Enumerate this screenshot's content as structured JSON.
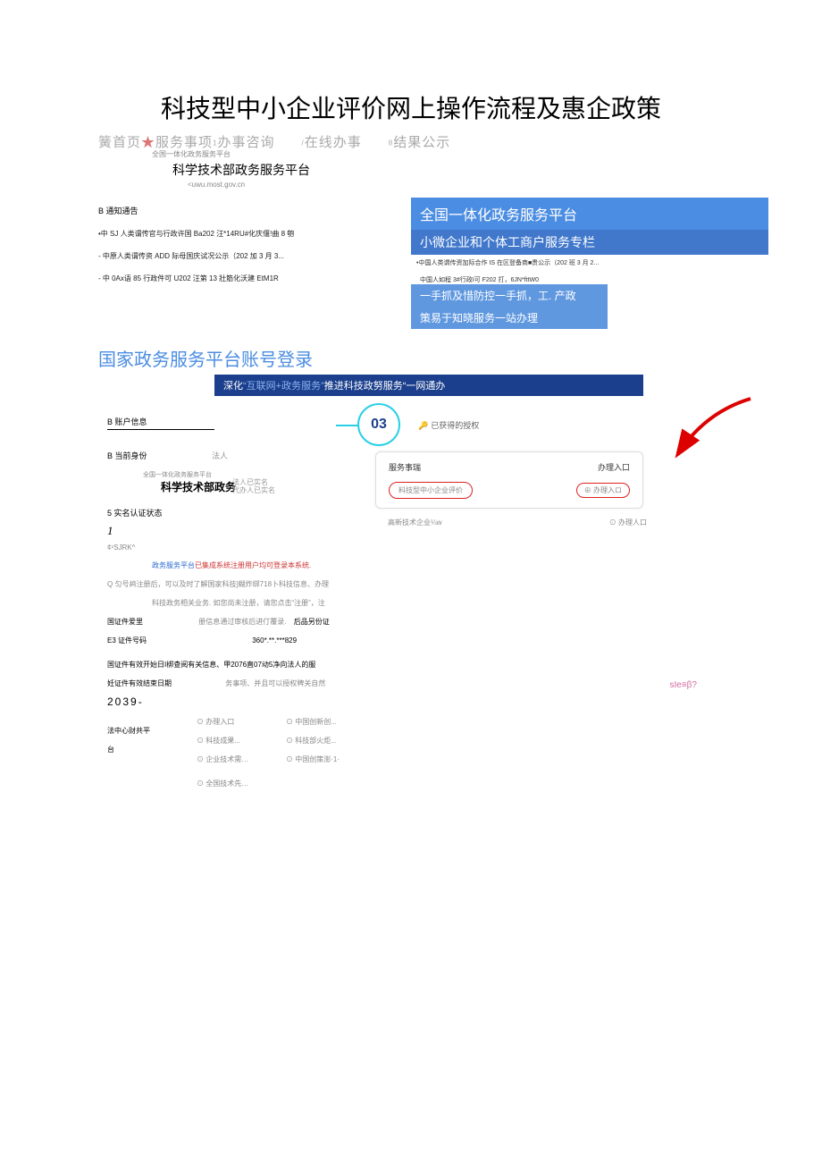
{
  "title": "科技型中小企业评价网上操作流程及惠企政策",
  "nav": {
    "n1_prefix": "簧",
    "n1": "首页",
    "star": "★",
    "n2": "服务事项",
    "idx3": "1",
    "n3": "办事咨询",
    "idx4": "/",
    "n4": "在线办事",
    "idx5": "8",
    "n5": "结果公示"
  },
  "subplatform": "全国一体化政务服务平台",
  "platform_title": "科学技术部政务服务平台",
  "platform_url": "<uwu.most.gov.cn",
  "notices": {
    "head": "B 通知通告",
    "i1": "•中 SJ 人类谓传官与行政许国 Ba202 汪*14RU#化庆偃!曲 8 匏",
    "i2": "- 中原人类谓传资 ADD 际母国庆试况公示（202 加 3 月 3...",
    "i3": "- 中 0Ax语 85 行政件可 U202 汪第 13 壯筋化沃建 EtM1R"
  },
  "right": {
    "banner1": "全国一体化政务服务平台",
    "banner2": "小微企业和个体工商户服务专栏",
    "note1": "•中国人类谓传资加际合作 IS 在区登备商■贵公示（202 班 3 月 2...",
    "mid": "中国人如程 3#行政I可 F202 打，6JN*fttW0",
    "banner3a": "一手抓及惜防控一手抓，工. 产政",
    "banner3b": "策易于知晓服务一站办理"
  },
  "login_section": "国家政务服务平台账号登录",
  "bluestrip": {
    "pre": "深化",
    "q": "“互联网+政务服务”",
    "post": "推进科技政努服务“一网通办"
  },
  "left_info": {
    "acct": "B 账户信息",
    "ident": "B 当前身份",
    "ident_v": "法人",
    "sub1": "全国一体化政务服务平台",
    "ov1": "法人已实名",
    "ov2": "代办人已实名",
    "most2": "科学技术部政务",
    "cert_state": "5 实名认证状态",
    "one": "1",
    "sjrk": "¢¹SJRK^",
    "line1a": "政务服务平台",
    "line1b": "已集成系统注册用户均可登录本系统.",
    "line2a": "Q 匀",
    "line2b": "号鸪注册后，可以及时了解国家科技]糊炸绑718卜科技信息、办理",
    "line3": "科技政务相关业务. 如您尚未注册，请您点击“注册”，注",
    "f_type": "国证件爱里",
    "f_type_note": "册信息通过审核后进仃覆录.",
    "f_type_v": "后品另份证",
    "f_num": "E3 证件号码",
    "f_num_v": "360*.**.***829",
    "f_start": "国证件有效开始日I梆查阅有关信息、甲2076直07动5净向法人的服",
    "f_end": "妊证件有效结束日期",
    "f_end_note": "务事项、并且可以授权稗关自然",
    "yr": "2039-"
  },
  "right_panel": {
    "step": "03",
    "auth": "已获得的授权",
    "col1": "服务事瑞",
    "col2": "办理入口",
    "item1": "料技型中小企业评价",
    "btn1": "⊕ 办理入ロ",
    "item2": "高新技术企业¼w",
    "btn2": "⊙ 办理人口"
  },
  "pink": "sIe≡β?",
  "grid": {
    "r1c1": "",
    "r1c2": "⊙ 办理入口",
    "r1c3": "⊙ 中国创新创...",
    "r2c1": "法中心财共平",
    "r2c2": "⊙ 科技成果...",
    "r2c3": "⊙ 科技部火炬...",
    "r3c1": "台",
    "r3c2": "⊙ 企业技术需…",
    "r3c3": "⊙ 中国创策澎·1·",
    "r4c2": "⊙ 全国技术先…"
  }
}
